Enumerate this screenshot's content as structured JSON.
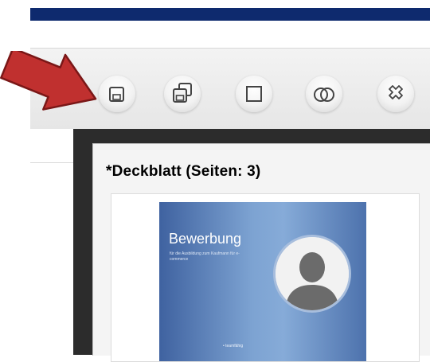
{
  "toolbar": {
    "buttons": [
      {
        "name": "save",
        "icon": "save-icon"
      },
      {
        "name": "save-all",
        "icon": "save-all-icon"
      },
      {
        "name": "new-page",
        "icon": "square-icon"
      },
      {
        "name": "merge",
        "icon": "overlap-circles-icon"
      },
      {
        "name": "close",
        "icon": "close-icon"
      }
    ]
  },
  "panel": {
    "title": "*Deckblatt (Seiten: 3)"
  },
  "cover": {
    "title": "Bewerbung",
    "subtitle": "für die Ausbildung zum Kaufmann für e-commerce",
    "bullet": "• teamfähig"
  },
  "colors": {
    "accent_bar": "#0e2a6e",
    "arrow": "#c0302f"
  }
}
